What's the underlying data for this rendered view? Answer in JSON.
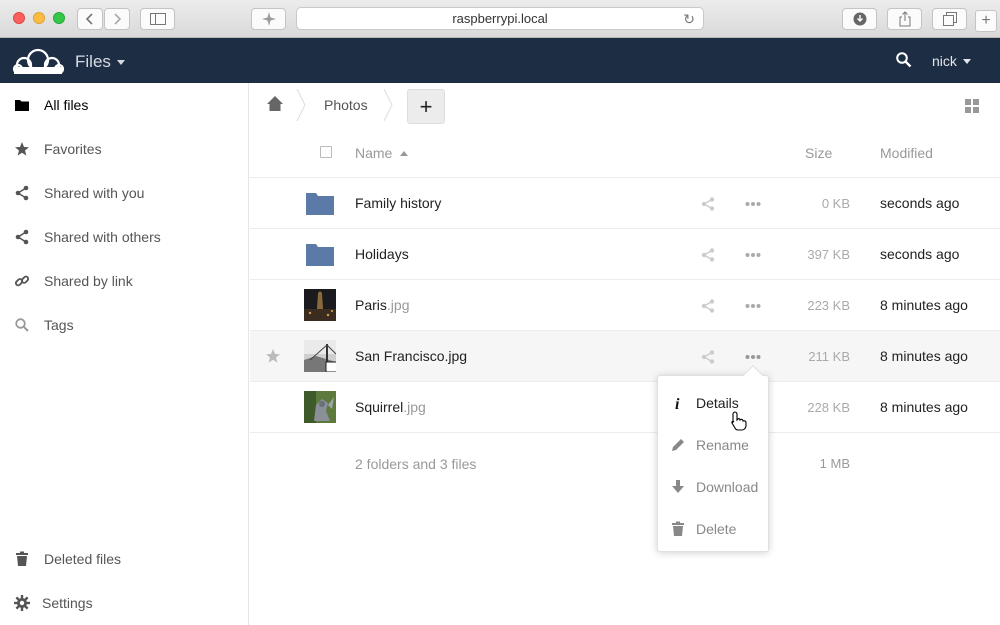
{
  "browser": {
    "url": "raspberrypi.local"
  },
  "header": {
    "app_title": "Files",
    "user": "nick"
  },
  "sidebar": {
    "items": [
      {
        "label": "All files",
        "icon": "folder-icon"
      },
      {
        "label": "Favorites",
        "icon": "star-icon"
      },
      {
        "label": "Shared with you",
        "icon": "share-icon"
      },
      {
        "label": "Shared with others",
        "icon": "share-icon"
      },
      {
        "label": "Shared by link",
        "icon": "link-icon"
      },
      {
        "label": "Tags",
        "icon": "search-icon"
      }
    ],
    "deleted_label": "Deleted files",
    "settings_label": "Settings"
  },
  "breadcrumb": {
    "current": "Photos",
    "add_label": "+"
  },
  "table": {
    "col_name": "Name",
    "col_size": "Size",
    "col_modified": "Modified",
    "rows": [
      {
        "name": "Family history",
        "ext": "",
        "type": "folder",
        "size": "0 KB",
        "modified": "seconds ago"
      },
      {
        "name": "Holidays",
        "ext": "",
        "type": "folder",
        "size": "397 KB",
        "modified": "seconds ago"
      },
      {
        "name": "Paris",
        "ext": ".jpg",
        "type": "image",
        "size": "223 KB",
        "modified": "8 minutes ago"
      },
      {
        "name": "San Francisco.jpg",
        "ext": "",
        "type": "image",
        "size": "211 KB",
        "modified": "8 minutes ago"
      },
      {
        "name": "Squirrel",
        "ext": ".jpg",
        "type": "image",
        "size": "228 KB",
        "modified": "8 minutes ago"
      }
    ],
    "summary_count": "2 folders and 3 files",
    "summary_size": "1 MB"
  },
  "menu": {
    "items": [
      {
        "label": "Details",
        "icon": "info-icon"
      },
      {
        "label": "Rename",
        "icon": "pencil-icon"
      },
      {
        "label": "Download",
        "icon": "download-icon"
      },
      {
        "label": "Delete",
        "icon": "trash-icon"
      }
    ]
  },
  "colors": {
    "header_bg": "#1d2d44",
    "folder": "#5b7aa8"
  }
}
